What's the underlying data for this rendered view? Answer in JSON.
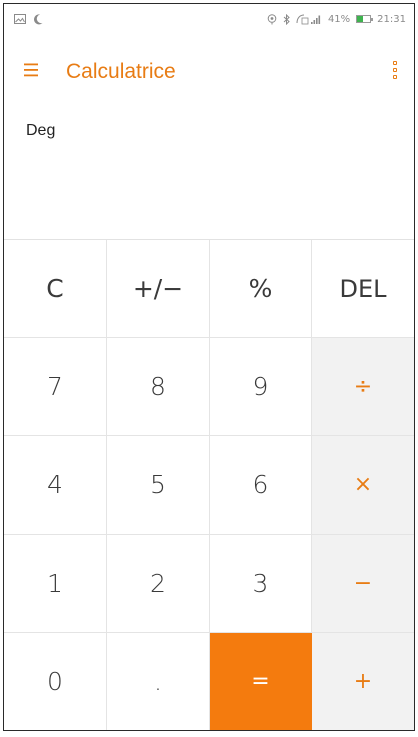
{
  "status_bar": {
    "battery_percent": "41%",
    "time": "21:31",
    "battery_level": 0.41,
    "icons_left": [
      "image-icon",
      "moon-icon"
    ],
    "icons_right": [
      "location-icon",
      "bluetooth-icon",
      "signal-icon",
      "battery-icon"
    ]
  },
  "app_bar": {
    "title": "Calculatrice",
    "accent_color": "#e87c14"
  },
  "display": {
    "mode": "Deg",
    "expression": ""
  },
  "keypad": {
    "rows": [
      [
        {
          "label": "C",
          "name": "clear-key",
          "kind": "top-op"
        },
        {
          "label": "+/−",
          "name": "sign-toggle-key",
          "kind": "top-op"
        },
        {
          "label": "%",
          "name": "percent-key",
          "kind": "top-op"
        },
        {
          "label": "DEL",
          "name": "delete-key",
          "kind": "top-op del"
        }
      ],
      [
        {
          "label": "7",
          "name": "digit-7-key",
          "kind": "digit"
        },
        {
          "label": "8",
          "name": "digit-8-key",
          "kind": "digit"
        },
        {
          "label": "9",
          "name": "digit-9-key",
          "kind": "digit"
        },
        {
          "label": "÷",
          "name": "divide-key",
          "kind": "op"
        }
      ],
      [
        {
          "label": "4",
          "name": "digit-4-key",
          "kind": "digit"
        },
        {
          "label": "5",
          "name": "digit-5-key",
          "kind": "digit"
        },
        {
          "label": "6",
          "name": "digit-6-key",
          "kind": "digit"
        },
        {
          "label": "×",
          "name": "multiply-key",
          "kind": "op"
        }
      ],
      [
        {
          "label": "1",
          "name": "digit-1-key",
          "kind": "digit"
        },
        {
          "label": "2",
          "name": "digit-2-key",
          "kind": "digit"
        },
        {
          "label": "3",
          "name": "digit-3-key",
          "kind": "digit"
        },
        {
          "label": "−",
          "name": "subtract-key",
          "kind": "op"
        }
      ],
      [
        {
          "label": "0",
          "name": "digit-0-key",
          "kind": "digit"
        },
        {
          "label": ".",
          "name": "decimal-point-key",
          "kind": "digit"
        },
        {
          "label": "=",
          "name": "equals-key",
          "kind": "equals"
        },
        {
          "label": "+",
          "name": "add-key",
          "kind": "op"
        }
      ]
    ]
  },
  "colors": {
    "accent": "#e87c14",
    "equals_bg": "#f47b0e",
    "operator_bg": "#f2f2f2",
    "battery_green": "#3fb34f"
  }
}
